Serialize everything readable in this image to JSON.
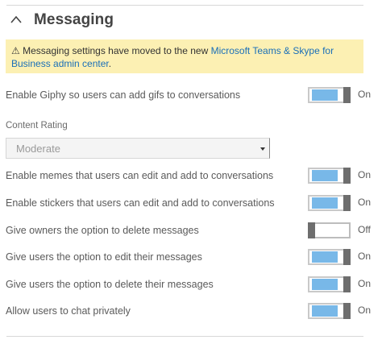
{
  "section": {
    "title": "Messaging",
    "collapse_icon": "chevron-up-icon"
  },
  "notice": {
    "icon": "⚠",
    "text_before": "Messaging settings have moved to the new ",
    "link_text": "Microsoft Teams & Skype for Business admin center",
    "text_after": ".",
    "background": "#fcf0b3",
    "link_color": "#1a6fb8"
  },
  "settings": {
    "giphy": {
      "label": "Enable Giphy so users can add gifs to conversations",
      "state": "On"
    },
    "content_rating": {
      "label": "Content Rating",
      "value": "Moderate"
    },
    "memes": {
      "label": "Enable memes that users can edit and add to conversations",
      "state": "On"
    },
    "stickers": {
      "label": "Enable stickers that users can edit and add to conversations",
      "state": "On"
    },
    "owners_delete": {
      "label": "Give owners the option to delete messages",
      "state": "Off"
    },
    "users_edit": {
      "label": "Give users the option to edit their messages",
      "state": "On"
    },
    "users_delete": {
      "label": "Give users the option to delete their messages",
      "state": "On"
    },
    "private_chat": {
      "label": "Allow users to chat privately",
      "state": "On"
    }
  },
  "colors": {
    "toggle_on_fill": "#78b8e8",
    "toggle_thumb": "#6e6e6e"
  }
}
